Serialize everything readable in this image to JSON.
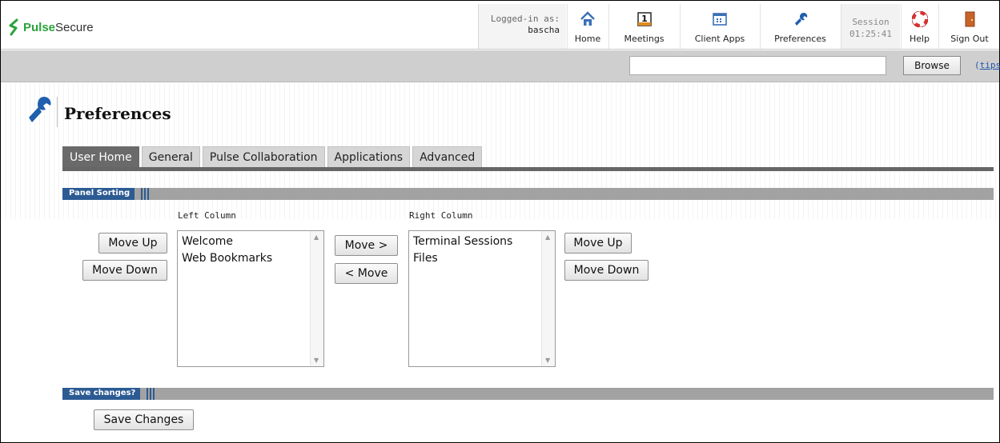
{
  "brand": {
    "name_a": "Pulse",
    "name_b": "Secure"
  },
  "header": {
    "logged_label": "Logged-in as:",
    "user": "bascha",
    "nav": [
      {
        "label": "Home",
        "icon": "home-icon"
      },
      {
        "label": "Meetings",
        "icon": "calendar-icon"
      },
      {
        "label": "Client Apps",
        "icon": "client-apps-icon"
      },
      {
        "label": "Preferences",
        "icon": "wrench-icon"
      },
      {
        "label": "Help",
        "icon": "lifebuoy-icon"
      },
      {
        "label": "Sign Out",
        "icon": "door-icon"
      }
    ],
    "session_label": "Session",
    "session_time": "01:25:41",
    "meetings_day": "1"
  },
  "toolbar": {
    "browse_value": "",
    "browse_label": "Browse",
    "tips_open": "(",
    "tips_label": "tips",
    "tips_close": ")"
  },
  "page": {
    "title": "Preferences"
  },
  "tabs": [
    {
      "label": "User Home",
      "active": true
    },
    {
      "label": "General"
    },
    {
      "label": "Pulse Collaboration"
    },
    {
      "label": "Applications"
    },
    {
      "label": "Advanced"
    }
  ],
  "panel_sorting": {
    "section_label": "Panel Sorting",
    "left_column_label": "Left Column",
    "right_column_label": "Right Column",
    "left_items": [
      "Welcome",
      "Web Bookmarks"
    ],
    "right_items": [
      "Terminal Sessions",
      "Files"
    ],
    "move_up": "Move Up",
    "move_down": "Move Down",
    "move_right": "Move >",
    "move_left": "< Move"
  },
  "save": {
    "section_label": "Save changes?",
    "button_label": "Save Changes"
  },
  "colors": {
    "brand_green": "#2aa33a",
    "section_blue": "#2c5b93",
    "wrench_blue": "#1f5fae"
  }
}
